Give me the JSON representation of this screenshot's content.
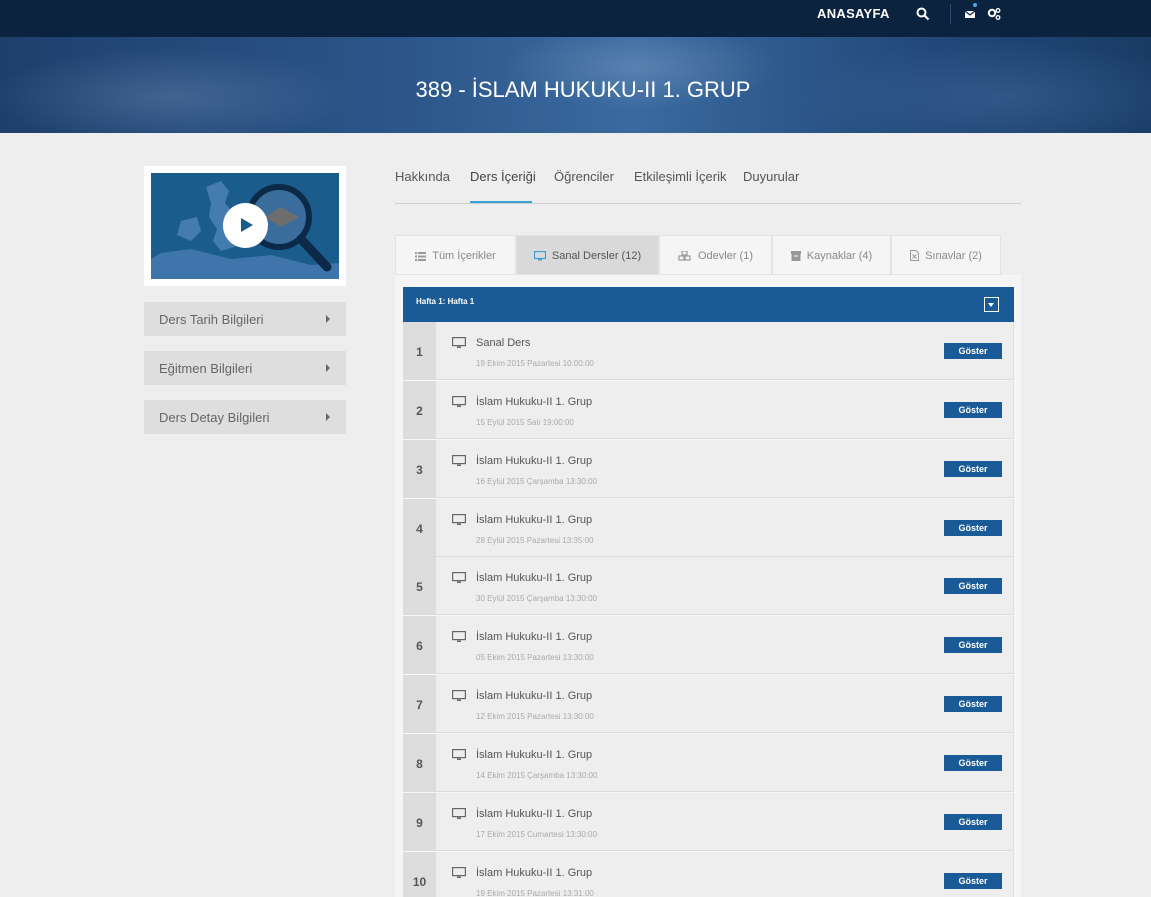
{
  "topbar": {
    "home_label": "ANASAYFA",
    "icons": [
      "search-icon",
      "mail-icon",
      "settings-icon"
    ],
    "notification_color": "#4da6e8"
  },
  "banner": {
    "title": "389 - İSLAM HUKUKU-II 1. GRUP"
  },
  "sidebar": {
    "video_icon": "play-icon",
    "items": [
      {
        "label": "Ders Tarih Bilgileri"
      },
      {
        "label": "Eğitmen Bilgileri"
      },
      {
        "label": "Ders Detay Bilgileri"
      }
    ]
  },
  "main_tabs": [
    {
      "label": "Hakkında"
    },
    {
      "label": "Ders İçeriği"
    },
    {
      "label": "Öğrenciler"
    },
    {
      "label": "Etkileşimli İçerik"
    },
    {
      "label": "Duyurular"
    }
  ],
  "active_main_tab": "Ders İçeriği",
  "content_tabs": [
    {
      "label": "Tüm İçerikler",
      "icon": "list-icon"
    },
    {
      "label": "Sanal Dersler (12)",
      "icon": "monitor-icon"
    },
    {
      "label": "Odevler (1)",
      "icon": "cubes-icon"
    },
    {
      "label": "Kaynaklar (4)",
      "icon": "archive-icon"
    },
    {
      "label": "Sınavlar (2)",
      "icon": "exam-file-icon"
    }
  ],
  "active_content_tab": "Sanal Dersler (12)",
  "week": {
    "title": "Hafta 1: Hafta 1"
  },
  "sessions": [
    {
      "num": "1",
      "title": "Sanal Ders",
      "date": "19 Ekim 2015 Pazartesi 10:00:00",
      "button": "Göster"
    },
    {
      "num": "2",
      "title": "İslam Hukuku-II 1. Grup",
      "date": "15 Eylül 2015 Salı 19:00:00",
      "button": "Göster"
    },
    {
      "num": "3",
      "title": "İslam Hukuku-II 1. Grup",
      "date": "16 Eylül 2015 Çarşamba 13:30:00",
      "button": "Göster"
    },
    {
      "num": "4",
      "title": "İslam Hukuku-II 1. Grup",
      "date": "28 Eylül 2015 Pazartesi 13:35:00",
      "button": "Göster"
    },
    {
      "num": "5",
      "title": "İslam Hukuku-II 1. Grup",
      "date": "30 Eylül 2015 Çarşamba 13:30:00",
      "button": "Göster"
    },
    {
      "num": "6",
      "title": "İslam Hukuku-II 1. Grup",
      "date": "05 Ekim 2015 Pazartesi 13:30:00",
      "button": "Göster"
    },
    {
      "num": "7",
      "title": "İslam Hukuku-II 1. Grup",
      "date": "12 Ekim 2015 Pazartesi 13:30:00",
      "button": "Göster"
    },
    {
      "num": "8",
      "title": "İslam Hukuku-II 1. Grup",
      "date": "14 Ekim 2015 Çarşamba 13:30:00",
      "button": "Göster"
    },
    {
      "num": "9",
      "title": "İslam Hukuku-II 1. Grup",
      "date": "17 Ekim 2015 Cumartesi 13:30:00",
      "button": "Göster"
    },
    {
      "num": "10",
      "title": "İslam Hukuku-II 1. Grup",
      "date": "19 Ekim 2015 Pazartesi 13:31:00",
      "button": "Göster"
    }
  ],
  "colors": {
    "accent": "#1a5a96",
    "topbar": "#0c2340",
    "tab_underline": "#3ba0d8"
  }
}
